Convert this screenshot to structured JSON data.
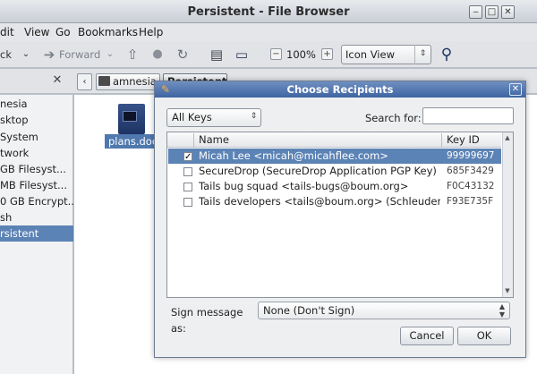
{
  "window": {
    "title": "Persistent - File Browser",
    "controls": [
      "minimize",
      "maximize",
      "close"
    ]
  },
  "menubar": [
    "dit",
    "View",
    "Go",
    "Bookmarks",
    "Help"
  ],
  "toolbar": {
    "back_label": "ck",
    "forward_label": "Forward",
    "zoom_level": "100%",
    "view_mode": "Icon View"
  },
  "location": {
    "crumbs": [
      "amnesia",
      "Persistent"
    ]
  },
  "sidebar": {
    "items": [
      {
        "label": "nesia",
        "selected": false
      },
      {
        "label": "sktop",
        "selected": false
      },
      {
        "label": "System",
        "selected": false
      },
      {
        "label": "twork",
        "selected": false
      },
      {
        "label": "GB Filesyst...",
        "selected": false
      },
      {
        "label": "MB Filesyst...",
        "selected": false
      },
      {
        "label": "0 GB Encrypt...",
        "selected": false
      },
      {
        "label": "sh",
        "selected": false
      },
      {
        "label": "rsistent",
        "selected": true
      }
    ]
  },
  "files": [
    {
      "name": "plans.docx",
      "selected": true
    }
  ],
  "dialog": {
    "title": "Choose Recipients",
    "filter": "All Keys",
    "search_label": "Search for:",
    "search_value": "",
    "columns": {
      "name": "Name",
      "key_id": "Key ID"
    },
    "recipients": [
      {
        "checked": true,
        "selected": true,
        "name": "Micah Lee <micah@micahflee.com>",
        "key_id": "99999697"
      },
      {
        "checked": false,
        "selected": false,
        "name": "SecureDrop (SecureDrop Application PGP Key)",
        "key_id": "685F3429"
      },
      {
        "checked": false,
        "selected": false,
        "name": "Tails bug squad <tails-bugs@boum.org>",
        "key_id": "F0C43132"
      },
      {
        "checked": false,
        "selected": false,
        "name": "Tails developers <tails@boum.org> (Schleuder maili...",
        "key_id": "F93E735F"
      }
    ],
    "sign_label": "Sign message as:",
    "sign_value": "None (Don't Sign)",
    "cancel_label": "Cancel",
    "ok_label": "OK"
  }
}
